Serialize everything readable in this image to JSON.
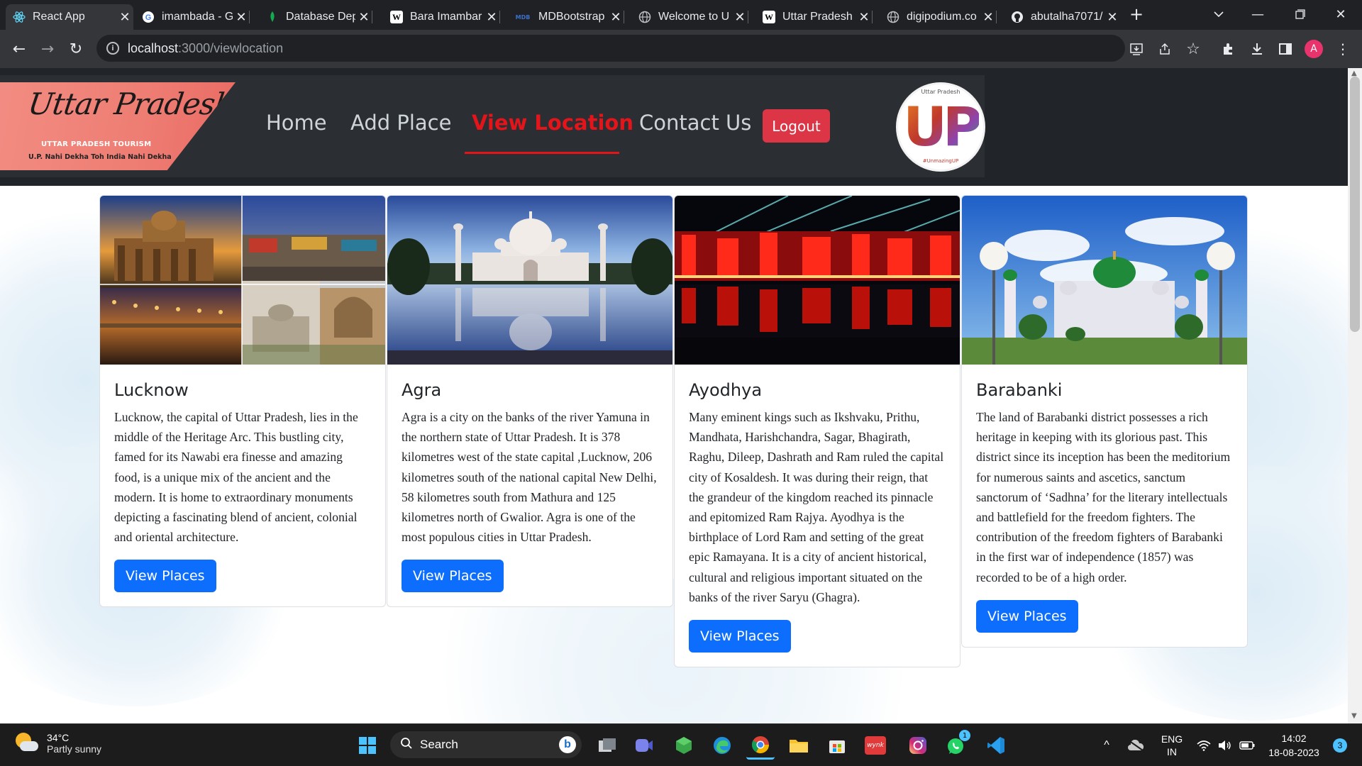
{
  "browser": {
    "tabs": [
      {
        "title": "React App",
        "favicon": "react-icon",
        "active": true
      },
      {
        "title": "imambada - G",
        "favicon": "google-icon"
      },
      {
        "title": "Database Dep",
        "favicon": "mongodb-icon"
      },
      {
        "title": "Bara Imambar",
        "favicon": "wikipedia-icon"
      },
      {
        "title": "MDBootstrap",
        "favicon": "mdb-icon"
      },
      {
        "title": "Welcome to U",
        "favicon": "globe-icon"
      },
      {
        "title": "Uttar Pradesh",
        "favicon": "wikipedia-icon"
      },
      {
        "title": "digipodium.co",
        "favicon": "globe-icon"
      },
      {
        "title": "abutalha7071/",
        "favicon": "github-icon"
      }
    ],
    "url_host": "localhost",
    "url_path": ":3000/viewlocation",
    "profile_initial": "A"
  },
  "site": {
    "logo_script": "Uttar Pradesh",
    "logo_tagline": "UTTAR PRADESH TOURISM",
    "logo_slogan": "U.P. Nahi Dekha Toh India Nahi Dekha",
    "nav": [
      {
        "label": "Home"
      },
      {
        "label": "Add Place"
      },
      {
        "label": "View Location",
        "active": true
      },
      {
        "label": "Contact Us"
      }
    ],
    "logout_label": "Logout",
    "badge_text": "UP",
    "badge_top": "Uttar Pradesh",
    "badge_bottom": "#UnmazingUP"
  },
  "cards": [
    {
      "title": "Lucknow",
      "text": "Lucknow, the capital of Uttar Pradesh, lies in the middle of the Heritage Arc. This bustling city, famed for its Nawabi era finesse and amazing food, is a unique mix of the ancient and the modern. It is home to extraordinary monuments depicting a fascinating blend of ancient, colonial and oriental architecture.",
      "button": "View Places"
    },
    {
      "title": "Agra",
      "text": "Agra is a city on the banks of the river Yamuna in the northern state of Uttar Pradesh. It is 378 kilometres west of the state capital ,Lucknow, 206 kilometres south of the national capital New Delhi, 58 kilometres south from Mathura and 125 kilometres north of Gwalior. Agra is one of the most populous cities in Uttar Pradesh.",
      "button": "View Places"
    },
    {
      "title": "Ayodhya",
      "text": "Many eminent kings such as Ikshvaku, Prithu, Mandhata, Harishchandra, Sagar, Bhagirath, Raghu, Dileep, Dashrath and Ram ruled the capital city of Kosaldesh. It was during their reign, that the grandeur of the kingdom reached its pinnacle and epitomized Ram Rajya. Ayodhya is the birthplace of Lord Ram and setting of the great epic Ramayana. It is a city of ancient historical, cultural and religious important situated on the banks of the river Saryu (Ghagra).",
      "button": "View Places"
    },
    {
      "title": "Barabanki",
      "text": "The land of Barabanki district possesses a rich heritage in keeping with its glorious past. This district since its inception has been the meditorium for numerous saints and ascetics, sanctum sanctorum of ‘Sadhna’ for the literary intellectuals and battlefield for the freedom fighters. The contribution of the freedom fighters of Barabanki in the first war of independence (1857) was recorded to be of a high order.",
      "button": "View Places"
    }
  ],
  "taskbar": {
    "temperature": "34°C",
    "weather": "Partly sunny",
    "search_label": "Search",
    "lang": "ENG",
    "region": "IN",
    "time": "14:02",
    "date": "18-08-2023",
    "notification_count": "3",
    "whatsapp_badge": "1",
    "wynk_label": "wynk"
  },
  "colors": {
    "accent_red": "#e4141b",
    "logout_red": "#dc3545",
    "button_blue": "#0d6efd",
    "header_dark": "#212529"
  }
}
